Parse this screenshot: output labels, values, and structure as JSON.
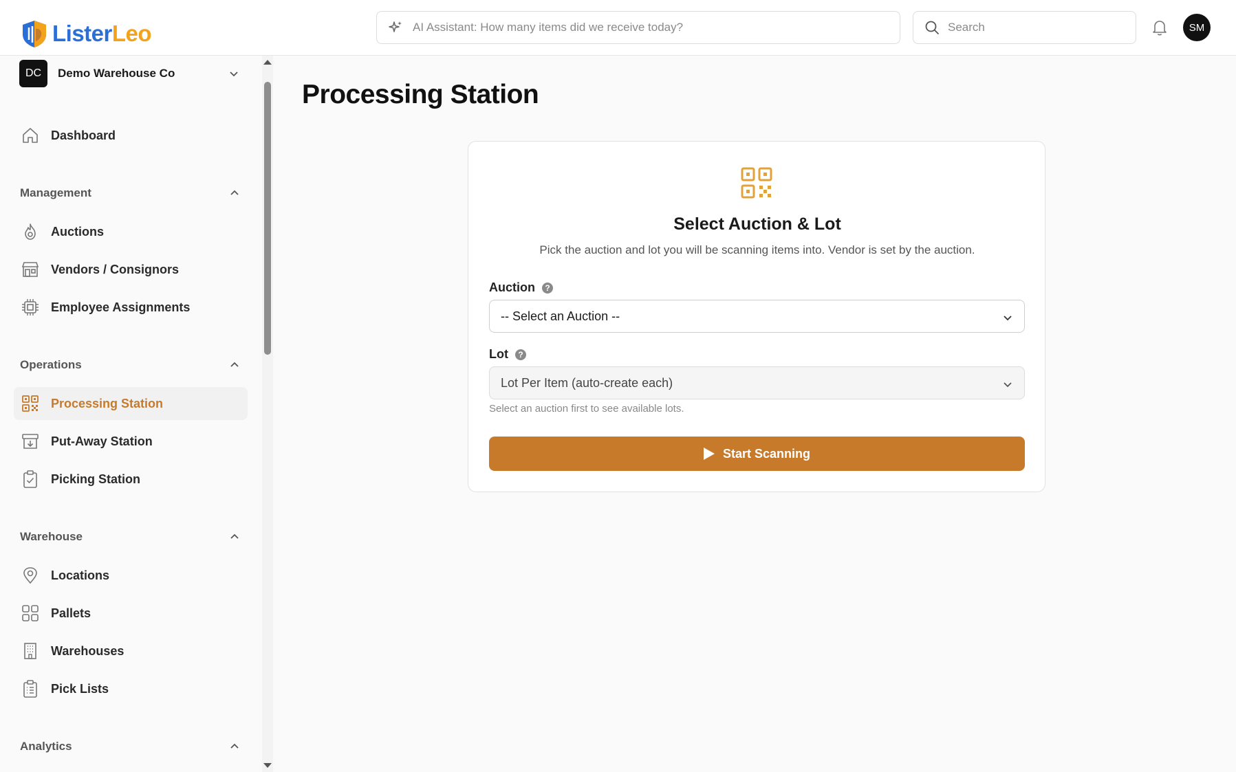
{
  "app": {
    "logo_part1": "Lister",
    "logo_part2": "Leo",
    "brand_blue": "#2b6fd6",
    "brand_gold": "#f2a31b",
    "accent": "#c77a2a"
  },
  "header": {
    "ai_placeholder": "AI Assistant: How many items did we receive today?",
    "search_placeholder": "Search",
    "avatar_initials": "SM",
    "icons": [
      "sparkle-icon",
      "search-icon",
      "bell-icon"
    ]
  },
  "sidebar": {
    "org": {
      "initials": "DC",
      "name": "Demo Warehouse Co"
    },
    "dashboard": {
      "label": "Dashboard",
      "icon": "home-icon"
    },
    "sections": [
      {
        "title": "Management",
        "items": [
          {
            "label": "Auctions",
            "icon": "auction-icon"
          },
          {
            "label": "Vendors / Consignors",
            "icon": "store-icon"
          },
          {
            "label": "Employee Assignments",
            "icon": "chip-icon"
          }
        ]
      },
      {
        "title": "Operations",
        "items": [
          {
            "label": "Processing Station",
            "icon": "qr-code-icon",
            "active": true
          },
          {
            "label": "Put-Away Station",
            "icon": "archive-down-icon"
          },
          {
            "label": "Picking Station",
            "icon": "clipboard-check-icon"
          }
        ]
      },
      {
        "title": "Warehouse",
        "items": [
          {
            "label": "Locations",
            "icon": "map-pin-icon"
          },
          {
            "label": "Pallets",
            "icon": "grid-icon"
          },
          {
            "label": "Warehouses",
            "icon": "building-icon"
          },
          {
            "label": "Pick Lists",
            "icon": "clipboard-list-icon"
          }
        ]
      },
      {
        "title": "Analytics",
        "items": []
      }
    ]
  },
  "main": {
    "title": "Processing Station",
    "card": {
      "title": "Select Auction & Lot",
      "subtitle": "Pick the auction and lot you will be scanning items into. Vendor is set by the auction.",
      "auction_label": "Auction",
      "auction_value": "-- Select an Auction --",
      "lot_label": "Lot",
      "lot_value": "Lot Per Item (auto-create each)",
      "lot_hint": "Select an auction first to see available lots.",
      "help_glyph": "?",
      "start_button": "Start Scanning"
    }
  }
}
